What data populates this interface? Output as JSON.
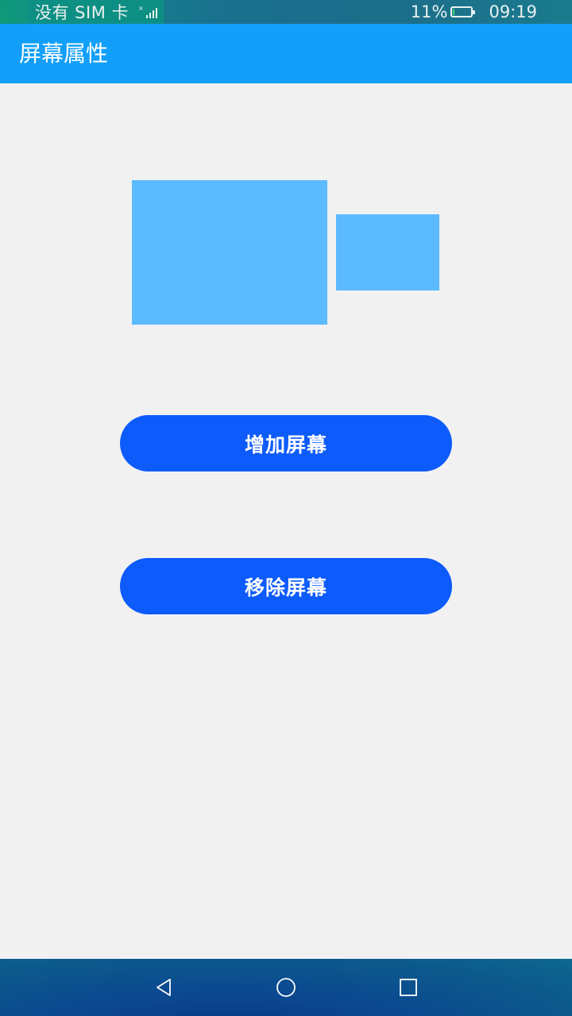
{
  "status_bar": {
    "carrier": "没有 SIM 卡",
    "battery_percent": "11%",
    "battery_level": 0.11,
    "time": "09:19"
  },
  "app_bar": {
    "title": "屏幕属性"
  },
  "screens": {
    "count": 2,
    "color": "#5cbaff"
  },
  "buttons": {
    "add_label": "增加屏幕",
    "remove_label": "移除屏幕",
    "color": "#0d5bfa"
  },
  "nav": {
    "back_icon": "triangle-back-icon",
    "home_icon": "circle-home-icon",
    "recent_icon": "square-recent-icon"
  },
  "colors": {
    "app_bar": "#119ff9",
    "background": "#f1f1f2"
  }
}
